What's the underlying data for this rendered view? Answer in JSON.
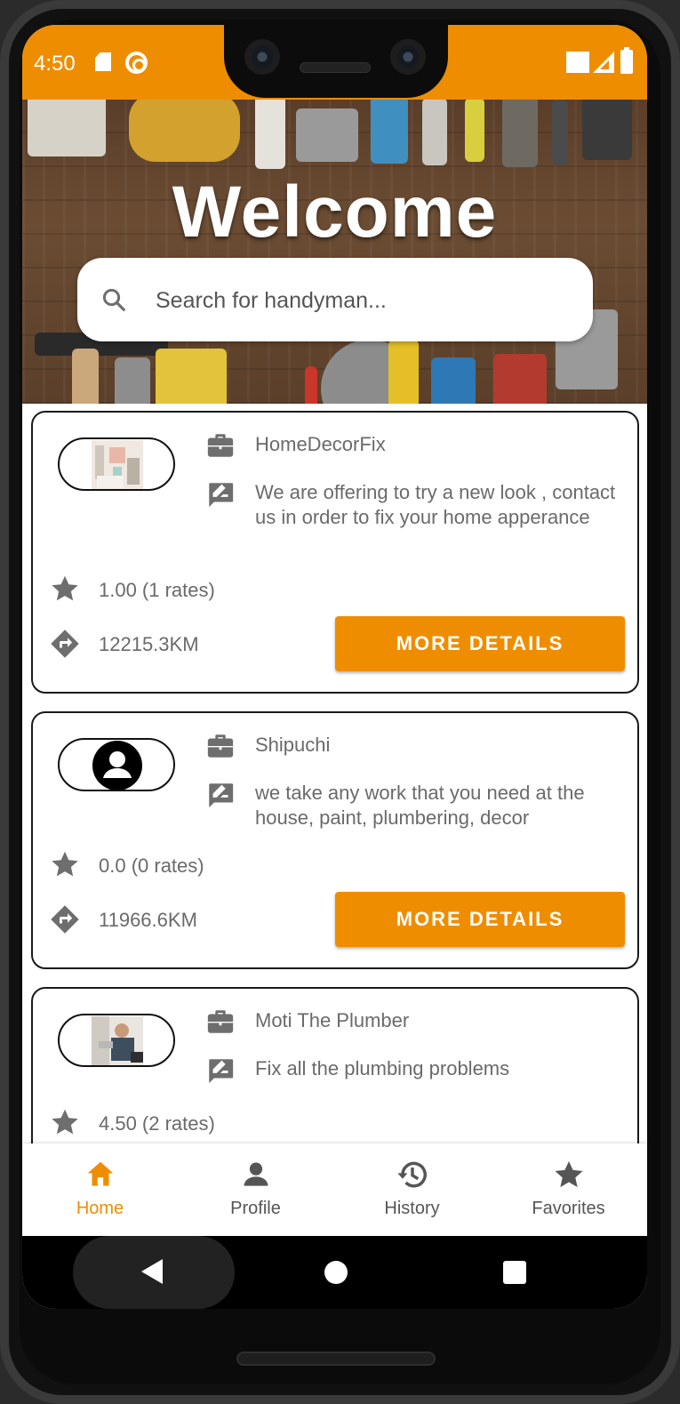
{
  "status_bar": {
    "time": "4:50"
  },
  "hero": {
    "title": "Welcome",
    "search_placeholder": "Search for handyman..."
  },
  "handymen": [
    {
      "name": "HomeDecorFix",
      "description": "We are offering to try a new look , contact us in order to fix your home apperance",
      "rating": "1.00 (1 rates)",
      "distance": "12215.3KM",
      "button": "MORE DETAILS"
    },
    {
      "name": "Shipuchi",
      "description": "we take any work that you need at the house, paint, plumbering, decor",
      "rating": "0.0 (0 rates)",
      "distance": "11966.6KM",
      "button": "MORE DETAILS"
    },
    {
      "name": "Moti The Plumber",
      "description": "Fix all the plumbing problems",
      "rating": "4.50 (2 rates)"
    }
  ],
  "bottom_nav": [
    {
      "label": "Home",
      "icon": "home-icon",
      "active": true
    },
    {
      "label": "Profile",
      "icon": "person-icon",
      "active": false
    },
    {
      "label": "History",
      "icon": "history-icon",
      "active": false
    },
    {
      "label": "Favorites",
      "icon": "star-icon",
      "active": false
    }
  ],
  "colors": {
    "accent": "#ef8d00",
    "text_gray": "#6a6a6a",
    "icon_gray": "#6e6e6e"
  }
}
